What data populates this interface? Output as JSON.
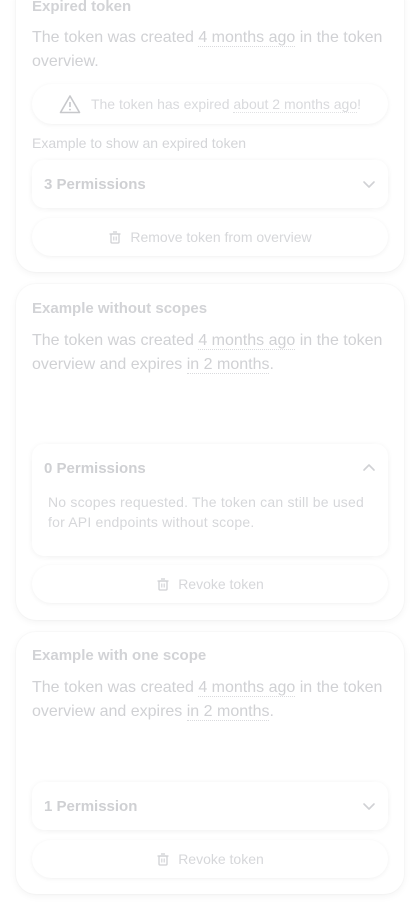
{
  "cards": [
    {
      "title": "Expired token",
      "desc_pre": "The token was created ",
      "desc_created": "4 months ago",
      "desc_mid": " in the token overview.",
      "alert_pre": "The token has expired ",
      "alert_when": "about 2 months ago",
      "alert_post": "!",
      "hint": "Example to show an expired token",
      "permissions_label": "3 Permissions",
      "action_label": "Remove token from overview"
    },
    {
      "title": "Example without scopes",
      "desc_pre": "The token was created ",
      "desc_created": "4 months ago",
      "desc_mid": " in the token overview and expires ",
      "desc_expires": "in 2 months",
      "desc_post": ".",
      "permissions_label": "0 Permissions",
      "permissions_body": "No scopes requested. The token can still be used for API endpoints without scope.",
      "action_label": "Revoke token"
    },
    {
      "title": "Example with one scope",
      "desc_pre": "The token was created ",
      "desc_created": "4 months ago",
      "desc_mid": " in the token overview and expires ",
      "desc_expires": "in 2 months",
      "desc_post": ".",
      "permissions_label": "1 Permission",
      "action_label": "Revoke token"
    }
  ],
  "icons": {
    "warning": "warning-triangle-icon",
    "trash": "trash-icon",
    "chevron_down": "chevron-down-icon",
    "chevron_up": "chevron-up-icon"
  },
  "colors": {
    "text": "#d0d1d4",
    "background": "#ffffff"
  }
}
